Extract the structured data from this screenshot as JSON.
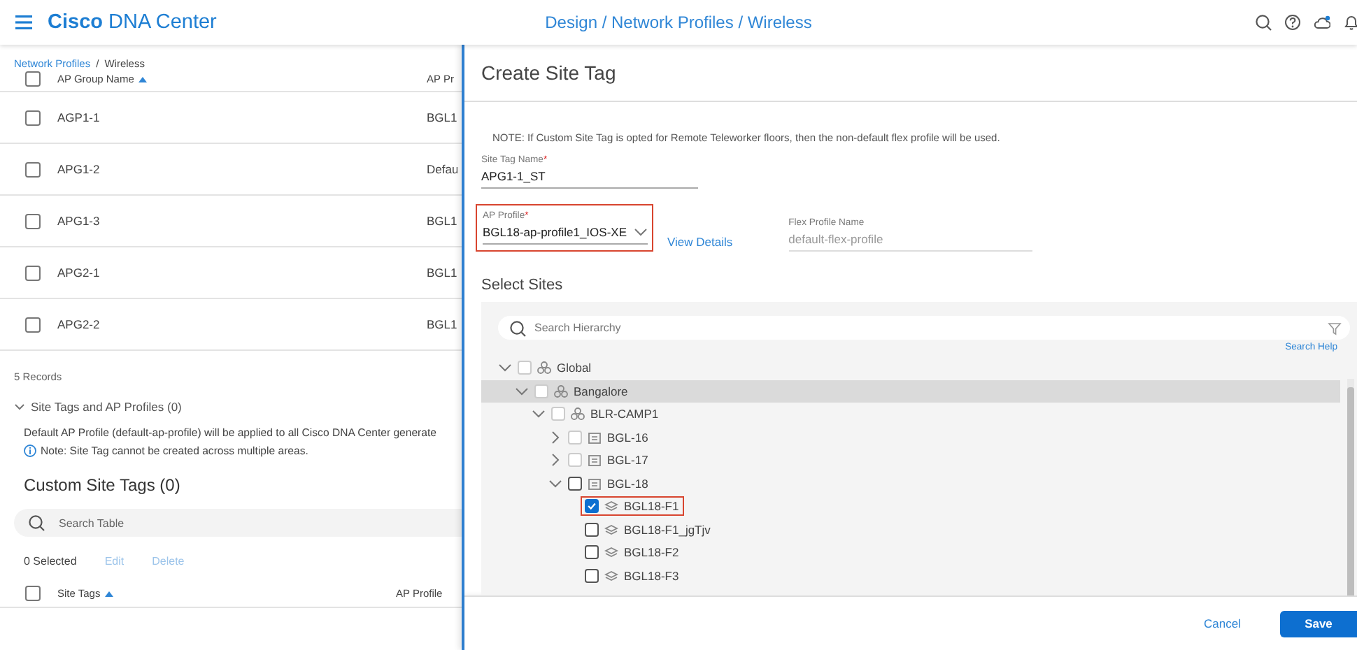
{
  "header": {
    "brand_bold": "Cisco",
    "brand": "DNA Center",
    "page_title": "Design / Network Profiles / Wireless"
  },
  "breadcrumb": [
    {
      "label": "Network Profiles",
      "link": true
    },
    {
      "label": "/",
      "link": false
    },
    {
      "label": "Wireless",
      "link": false
    }
  ],
  "ap_groups": {
    "all_checked": false,
    "columns": [
      {
        "label": "AP Group Name",
        "sorted": true
      },
      {
        "label": "AP Pr",
        "sorted": false
      }
    ],
    "rows": [
      {
        "checked": false,
        "cells": [
          "AGP1-1",
          "BGL1"
        ]
      },
      {
        "checked": false,
        "cells": [
          "APG1-2",
          "Defau"
        ]
      },
      {
        "checked": false,
        "cells": [
          "APG1-3",
          "BGL1"
        ]
      },
      {
        "checked": false,
        "cells": [
          "APG2-1",
          "BGL1"
        ]
      },
      {
        "checked": false,
        "cells": [
          "APG2-2",
          "BGL1"
        ]
      }
    ],
    "records": "5 Records"
  },
  "site_tags_section": {
    "title": "Site Tags and AP Profiles (0)",
    "expanded": true,
    "description": "Default AP Profile (default-ap-profile) will be applied to all Cisco DNA Center generate",
    "note": "Note: Site Tag cannot be created across multiple areas."
  },
  "custom_site_tags": {
    "all_checked": false,
    "title": "Custom Site Tags (0)",
    "search": {
      "placeholder": "Search Table"
    },
    "selected_count": "0 Selected",
    "actions": [
      {
        "label": "Edit",
        "disabled": true
      },
      {
        "label": "Delete",
        "disabled": true
      }
    ],
    "columns": [
      {
        "label": "Site Tags",
        "sorted": true
      },
      {
        "label": "AP Profile",
        "sorted": false
      }
    ]
  },
  "panel": {
    "title": "Create Site Tag",
    "note": "NOTE: If Custom Site Tag is opted for Remote Teleworker floors, then the non-default flex profile will be used.",
    "site_tag_name": {
      "label": "Site Tag Name",
      "required_mark": "*",
      "value": "APG1-1_ST"
    },
    "ap_profile": {
      "label": "AP Profile",
      "required_mark": "*",
      "value": "BGL18-ap-profile1_IOS-XE",
      "highlighted": true
    },
    "view_details": "View Details",
    "flex_profile": {
      "label": "Flex Profile Name",
      "value": "default-flex-profile",
      "disabled": true
    },
    "select_sites": "Select Sites",
    "search": {
      "placeholder": "Search Hierarchy"
    },
    "search_help": "Search Help",
    "tree": [
      {
        "name": "Global",
        "kind": "area",
        "expanded": true,
        "checked": false,
        "disabled": true,
        "selected": false,
        "highlighted": false,
        "children": [
          {
            "name": "Bangalore",
            "kind": "area",
            "expanded": true,
            "checked": false,
            "disabled": true,
            "selected": true,
            "highlighted": false,
            "children": [
              {
                "name": "BLR-CAMP1",
                "kind": "area",
                "expanded": true,
                "checked": false,
                "disabled": true,
                "selected": false,
                "highlighted": false,
                "children": [
                  {
                    "name": "BGL-16",
                    "kind": "building",
                    "expanded": false,
                    "checked": false,
                    "disabled": true,
                    "selected": false,
                    "highlighted": false
                  },
                  {
                    "name": "BGL-17",
                    "kind": "building",
                    "expanded": false,
                    "checked": false,
                    "disabled": true,
                    "selected": false,
                    "highlighted": false
                  },
                  {
                    "name": "BGL-18",
                    "kind": "building",
                    "expanded": true,
                    "checked": false,
                    "disabled": false,
                    "selected": false,
                    "highlighted": false,
                    "children": [
                      {
                        "name": "BGL18-F1",
                        "kind": "floor",
                        "checked": true,
                        "disabled": false,
                        "selected": false,
                        "highlighted": true
                      },
                      {
                        "name": "BGL18-F1_jgTjv",
                        "kind": "floor",
                        "checked": false,
                        "disabled": false,
                        "selected": false,
                        "highlighted": false
                      },
                      {
                        "name": "BGL18-F2",
                        "kind": "floor",
                        "checked": false,
                        "disabled": false,
                        "selected": false,
                        "highlighted": false
                      },
                      {
                        "name": "BGL18-F3",
                        "kind": "floor",
                        "checked": false,
                        "disabled": false,
                        "selected": false,
                        "highlighted": false
                      }
                    ]
                  }
                ]
              }
            ]
          }
        ]
      }
    ],
    "buttons": [
      {
        "label": "Cancel",
        "kind": "link"
      },
      {
        "label": "Save",
        "kind": "primary"
      }
    ]
  }
}
